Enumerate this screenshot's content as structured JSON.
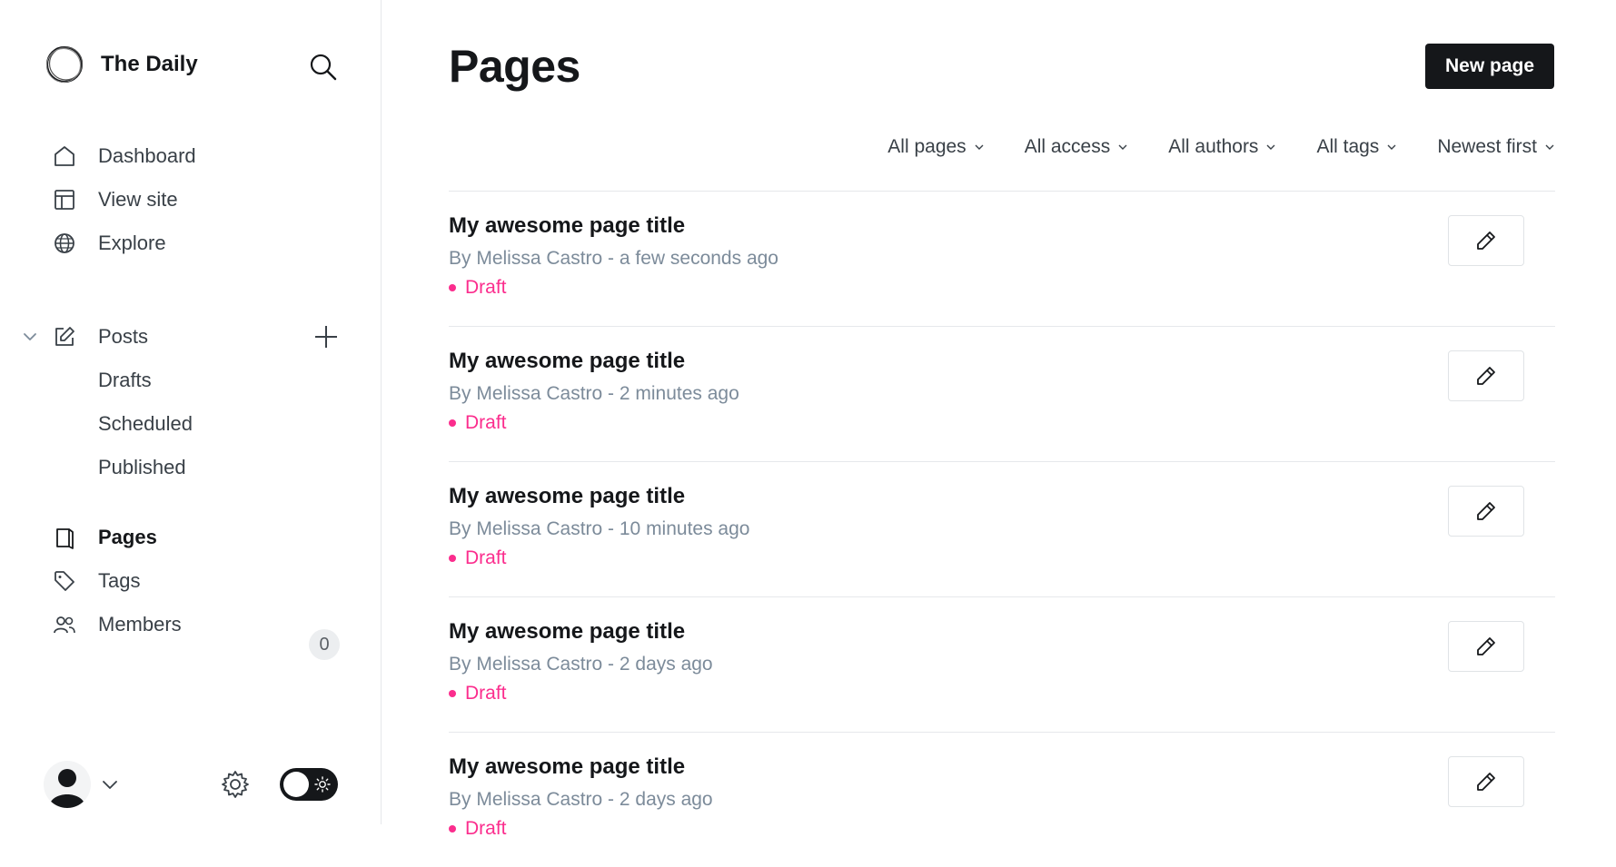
{
  "brand": {
    "name": "The Daily"
  },
  "nav": {
    "dashboard": "Dashboard",
    "view_site": "View site",
    "explore": "Explore",
    "posts": "Posts",
    "drafts": "Drafts",
    "scheduled": "Scheduled",
    "published": "Published",
    "pages": "Pages",
    "tags": "Tags",
    "members": "Members",
    "members_count": "0"
  },
  "header": {
    "title": "Pages",
    "new_button": "New page"
  },
  "filters": [
    "All pages",
    "All access",
    "All authors",
    "All tags",
    "Newest first"
  ],
  "pages": [
    {
      "title": "My awesome page title",
      "meta": "By Melissa Castro - a few seconds ago",
      "status": "Draft"
    },
    {
      "title": "My awesome page title",
      "meta": "By Melissa Castro - 2 minutes ago",
      "status": "Draft"
    },
    {
      "title": "My awesome page title",
      "meta": "By Melissa Castro - 10 minutes ago",
      "status": "Draft"
    },
    {
      "title": "My awesome page title",
      "meta": "By Melissa Castro - 2 days ago",
      "status": "Draft"
    },
    {
      "title": "My awesome page title",
      "meta": "By Melissa Castro - 2 days ago",
      "status": "Draft"
    }
  ],
  "theme": {
    "accent": "#15171a",
    "draft_color": "#fb2d8d",
    "muted_text": "#7c8b9a"
  },
  "icons": {
    "brand": "circle-logo-icon",
    "search": "search-icon",
    "dashboard": "home-icon",
    "view_site": "layout-icon",
    "explore": "globe-icon",
    "posts": "edit-icon",
    "pages": "page-icon",
    "tags": "tag-icon",
    "members": "users-icon",
    "settings": "gear-icon",
    "edit": "pencil-icon",
    "theme": "sun-icon"
  }
}
